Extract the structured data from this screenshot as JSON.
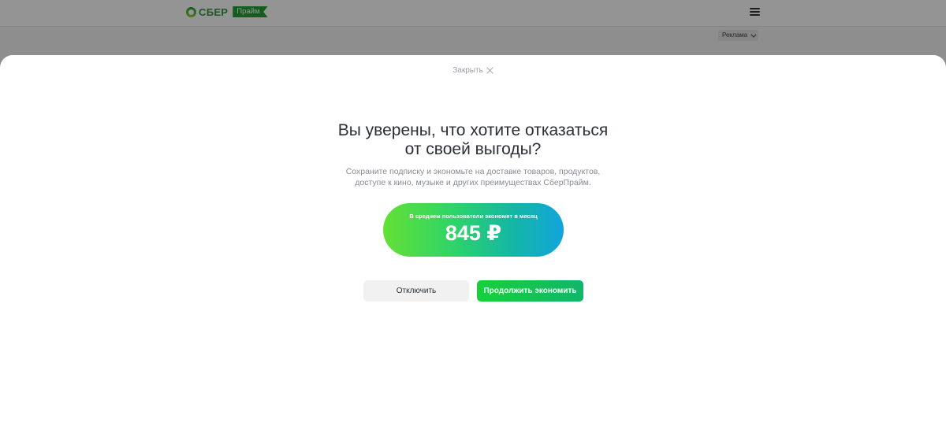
{
  "background": {
    "logo": {
      "brand": "СБЕР",
      "badge": "Прайм"
    },
    "menu_icon": "hamburger-icon",
    "ad_chip": {
      "label": "Реклама",
      "icon": "chevron-down-icon"
    }
  },
  "modal": {
    "close_label": "Закрыть",
    "close_icon": "close-icon",
    "title_line1": "Вы уверены, что хотите отказаться",
    "title_line2": "от своей выгоды?",
    "subtitle_line1": "Сохраните подписку и экономьте на доставке товаров, продуктов,",
    "subtitle_line2": "доступе к кино, музыке и других преимуществах СберПрайм.",
    "savings": {
      "caption": "В среднем пользователи экономят в месяц",
      "value": "845 ₽"
    },
    "buttons": {
      "disable": "Отключить",
      "continue": "Продолжить экономить"
    }
  },
  "colors": {
    "brand_green": "#21a038",
    "gradient_start": "#63e034",
    "gradient_end": "#11a4dd",
    "continue_button": "#19d03a"
  }
}
